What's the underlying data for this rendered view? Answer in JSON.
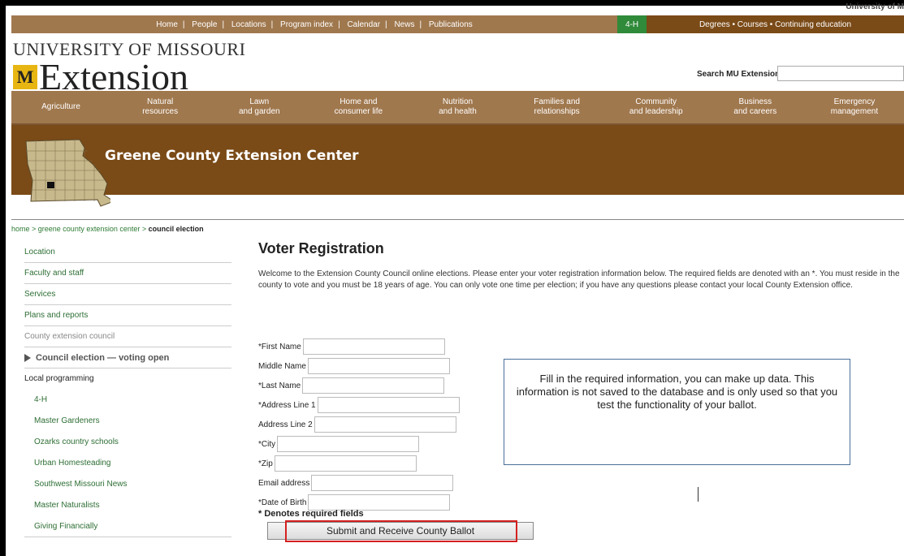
{
  "header": {
    "university_corner": "University of M",
    "top_nav": [
      "Home",
      "People",
      "Locations",
      "Program index",
      "Calendar",
      "News",
      "Publications"
    ],
    "four_h": "4-H",
    "degrees": "Degrees • Courses • Continuing education",
    "logo_line1": "UNIVERSITY OF MISSOURI",
    "logo_line2": "Extension",
    "search_label": "Search MU Extension",
    "search_value": ""
  },
  "categories": [
    {
      "l1": "",
      "l2": "Agriculture"
    },
    {
      "l1": "Natural",
      "l2": "resources"
    },
    {
      "l1": "Lawn",
      "l2": "and garden"
    },
    {
      "l1": "Home and",
      "l2": "consumer life"
    },
    {
      "l1": "Nutrition",
      "l2": "and health"
    },
    {
      "l1": "Families and",
      "l2": "relationships"
    },
    {
      "l1": "Community",
      "l2": "and leadership"
    },
    {
      "l1": "Business",
      "l2": "and careers"
    },
    {
      "l1": "Emergency",
      "l2": "management"
    }
  ],
  "banner": {
    "title": "Greene County Extension Center"
  },
  "breadcrumb": {
    "home": "home",
    "sep": " > ",
    "center": "greene county extension center",
    "current": "council election"
  },
  "sidebar": {
    "items": [
      "Location",
      "Faculty and staff",
      "Services",
      "Plans and reports"
    ],
    "muted": "County extension council",
    "active": "Council election — voting open",
    "heading": "Local programming",
    "sub": [
      "4-H",
      "Master Gardeners",
      "Ozarks country schools",
      "Urban Homesteading",
      "Southwest Missouri News",
      "Master Naturalists",
      "Giving Financially"
    ]
  },
  "main": {
    "title": "Voter Registration",
    "intro": "Welcome to the Extension County Council online elections. Please enter your voter registration information below. The required fields are denoted with an *. You must reside in the county to vote and you must be 18 years of age. You can only vote one time per election; if you have any questions please contact your local County Extension office."
  },
  "form": {
    "fields": [
      {
        "label": "*First Name",
        "value": ""
      },
      {
        "label": "Middle Name",
        "value": ""
      },
      {
        "label": "*Last Name",
        "value": ""
      },
      {
        "label": "*Address Line 1",
        "value": ""
      },
      {
        "label": "Address Line 2",
        "value": ""
      },
      {
        "label": "*City",
        "value": ""
      },
      {
        "label": "*Zip",
        "value": ""
      },
      {
        "label": "Email address",
        "value": ""
      },
      {
        "label": "*Date of Birth",
        "value": ""
      }
    ],
    "required_note": "* Denotes required fields",
    "submit_label": "Submit and Receive County Ballot"
  },
  "help": {
    "text": "Fill in the required information, you can make up data. This information is not saved to the database and is only used so that you test the functionality of your ballot."
  },
  "colors": {
    "brand_tan": "#a0784e",
    "brand_brown": "#7a4a17",
    "four_h_green": "#2f8a3a",
    "link_green": "#2d6e34",
    "highlight_red": "#d42020",
    "logo_gold": "#e8b612"
  }
}
